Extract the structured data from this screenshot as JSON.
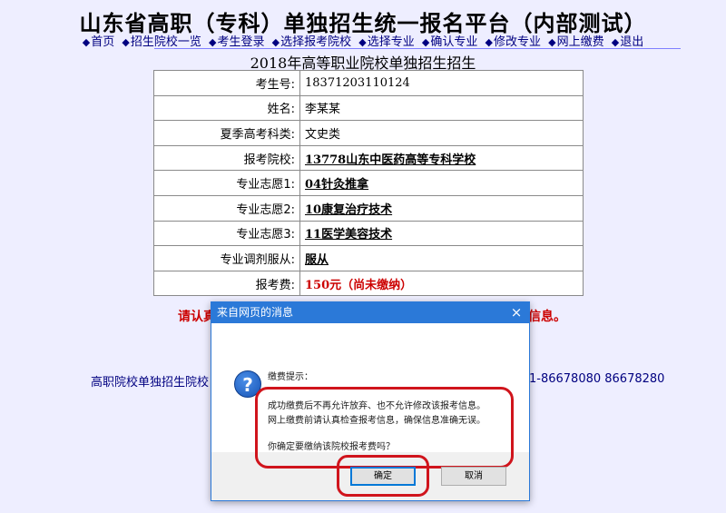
{
  "site": {
    "title": "山东省高职（专科）单独招生统一报名平台（内部测试）"
  },
  "nav": {
    "items": [
      {
        "label": "首页",
        "name": "nav-home"
      },
      {
        "label": "招生院校一览",
        "name": "nav-schools"
      },
      {
        "label": "考生登录",
        "name": "nav-login"
      },
      {
        "label": "选择报考院校",
        "name": "nav-select-school"
      },
      {
        "label": "选择专业",
        "name": "nav-select-major"
      },
      {
        "label": "确认专业",
        "name": "nav-confirm-major"
      },
      {
        "label": "修改专业",
        "name": "nav-modify-major"
      },
      {
        "label": "网上缴费",
        "name": "nav-payment"
      },
      {
        "label": "退出",
        "name": "nav-logout"
      }
    ]
  },
  "page": {
    "heading": "2018年高等职业院校单独招生招生"
  },
  "info": {
    "exam_no_label": "考生号:",
    "exam_no": "18371203110124",
    "name_label": "姓名:",
    "name": "李某某",
    "category_label": "夏季高考科类:",
    "category": "文史类",
    "school_label": "报考院校:",
    "school": "13778山东中医药高等专科学校",
    "major1_label": "专业志愿1:",
    "major1": "04针灸推拿",
    "major2_label": "专业志愿2:",
    "major2": "10康复治疗技术",
    "major3_label": "专业志愿3:",
    "major3": "11医学美容技术",
    "adjust_label": "专业调剂服从:",
    "adjust": "服从",
    "fee_label": "报考费:",
    "fee": "150元（尚未缴纳）"
  },
  "warning": {
    "head": "请认真",
    "tail": "信息。"
  },
  "footer": {
    "left": "高职院校单独招生院校",
    "right": "1-86678080  86678280"
  },
  "dialog": {
    "title": "来自网页的消息",
    "close": "×",
    "icon_glyph": "?",
    "icon": "question-icon",
    "message_title": "缴费提示：",
    "line1": "成功缴费后不再允许放弃、也不允许修改该报考信息。",
    "line2": "网上缴费前请认真检查报考信息，确保信息准确无误。",
    "line3": "你确定要缴纳该院校报考费吗？",
    "ok": "确定",
    "cancel": "取消"
  },
  "colors": {
    "background": "#eeeeff",
    "nav_link": "#000080",
    "warning": "#cc0000",
    "dialog_title": "#2b79d8",
    "highlight": "#d0141c"
  }
}
